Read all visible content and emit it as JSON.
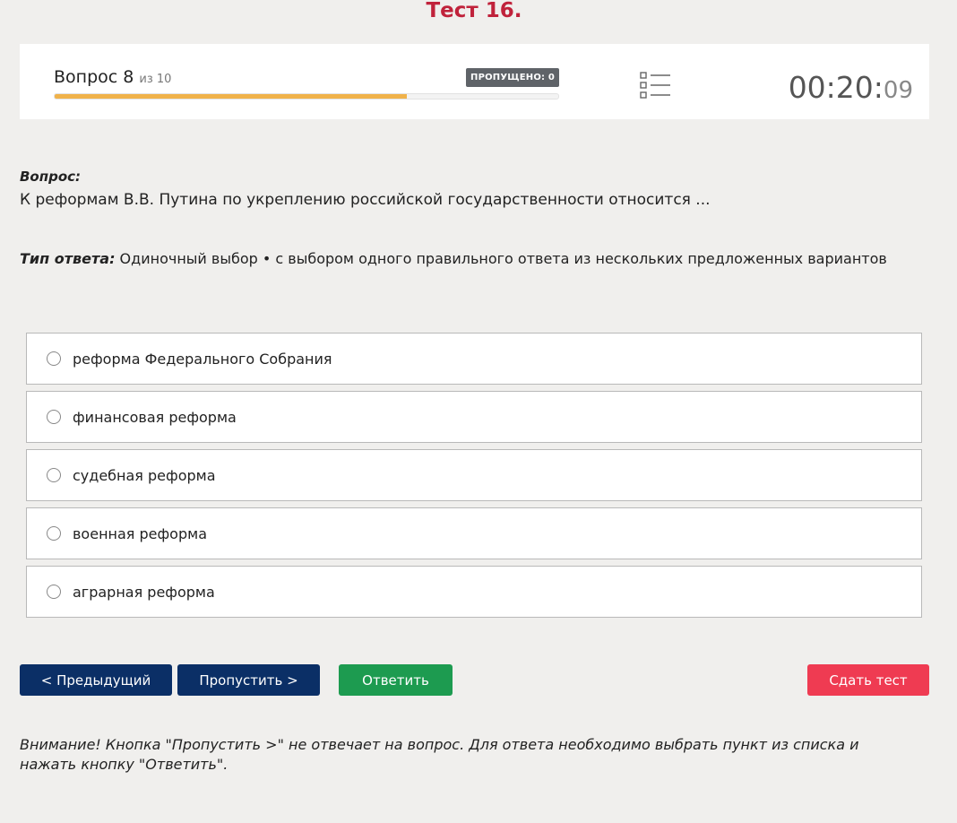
{
  "page": {
    "title": "Тест 16."
  },
  "header": {
    "question_label": "Вопрос 8",
    "question_of": "из 10",
    "skipped_badge": "ПРОПУЩЕНО: 0",
    "progress_fraction": 0.7,
    "timer_main": "00:20:",
    "timer_seconds": "09",
    "icons": {
      "question_list": "list-icon"
    }
  },
  "question": {
    "heading": "Вопрос:",
    "text": "К реформам В.В. Путина по укреплению российской государственности относится ...",
    "answer_type_label": "Тип ответа:",
    "answer_type_value": " Одиночный выбор • с выбором одного правильного ответа из нескольких предложенных вариантов"
  },
  "options": [
    {
      "label": "реформа Федерального Собрания"
    },
    {
      "label": "финансовая реформа"
    },
    {
      "label": "судебная реформа"
    },
    {
      "label": "военная реформа"
    },
    {
      "label": "аграрная реформа"
    }
  ],
  "buttons": {
    "prev": "< Предыдущий",
    "skip": "Пропустить >",
    "answer": "Ответить",
    "submit": "Сдать тест"
  },
  "warning": "Внимание! Кнопка \"Пропустить >\" не отвечает на вопрос. Для ответа необходимо выбрать пункт из списка и нажать кнопку \"Ответить\".",
  "colors": {
    "title": "#c0223b",
    "progress": "#f0b24a",
    "nav_button": "#0b2f66",
    "answer_button": "#1d9b50",
    "submit_button": "#ef3b52"
  }
}
